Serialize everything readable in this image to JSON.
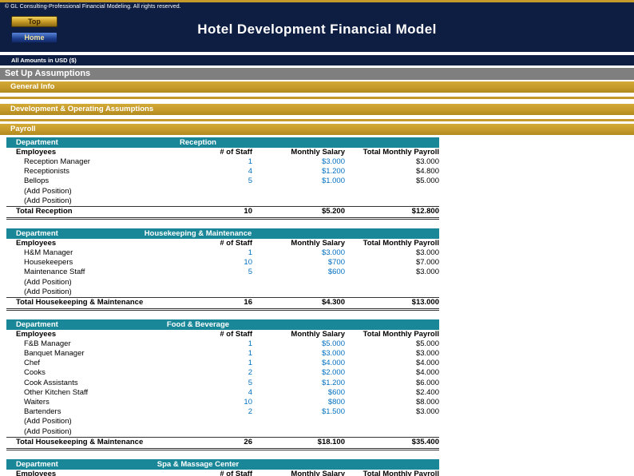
{
  "header": {
    "copyright": "© GL Consulting-Professional Financial Modeling. All rights reserved.",
    "title": "Hotel Development Financial Model",
    "top_button": "Top",
    "home_button": "Home"
  },
  "subheader": {
    "amounts_note": "All Amounts in  USD ($)"
  },
  "bands": {
    "setup": "Set Up Assumptions",
    "general_info": "General Info",
    "dev_ops": "Development & Operating Assumptions",
    "payroll": "Payroll"
  },
  "table": {
    "dept_label": "Department",
    "columns": [
      "Employees",
      "# of Staff",
      "Monthly Salary",
      "Total Monthly Payroll"
    ]
  },
  "sections": [
    {
      "name": "Reception",
      "rows": [
        {
          "label": "Reception Manager",
          "staff": "1",
          "salary": "$3.000",
          "total": "$3.000"
        },
        {
          "label": "Receptionists",
          "staff": "4",
          "salary": "$1.200",
          "total": "$4.800"
        },
        {
          "label": "Bellops",
          "staff": "5",
          "salary": "$1.000",
          "total": "$5.000"
        },
        {
          "label": "(Add Position)",
          "staff": "",
          "salary": "",
          "total": ""
        },
        {
          "label": "(Add Position)",
          "staff": "",
          "salary": "",
          "total": ""
        }
      ],
      "total": {
        "label": "Total Reception",
        "staff": "10",
        "salary": "$5.200",
        "total": "$12.800"
      }
    },
    {
      "name": "Housekeeping & Maintenance",
      "rows": [
        {
          "label": "H&M Manager",
          "staff": "1",
          "salary": "$3.000",
          "total": "$3.000"
        },
        {
          "label": "Housekeepers",
          "staff": "10",
          "salary": "$700",
          "total": "$7.000"
        },
        {
          "label": "Maintenance Staff",
          "staff": "5",
          "salary": "$600",
          "total": "$3.000"
        },
        {
          "label": "(Add Position)",
          "staff": "",
          "salary": "",
          "total": ""
        },
        {
          "label": "(Add Position)",
          "staff": "",
          "salary": "",
          "total": ""
        }
      ],
      "total": {
        "label": "Total Housekeeping & Maintenance",
        "staff": "16",
        "salary": "$4.300",
        "total": "$13.000"
      }
    },
    {
      "name": "Food & Beverage",
      "rows": [
        {
          "label": "F&B Manager",
          "staff": "1",
          "salary": "$5.000",
          "total": "$5.000"
        },
        {
          "label": "Banquet Manager",
          "staff": "1",
          "salary": "$3.000",
          "total": "$3.000"
        },
        {
          "label": "Chef",
          "staff": "1",
          "salary": "$4.000",
          "total": "$4.000"
        },
        {
          "label": "Cooks",
          "staff": "2",
          "salary": "$2.000",
          "total": "$4.000"
        },
        {
          "label": "Cook Assistants",
          "staff": "5",
          "salary": "$1.200",
          "total": "$6.000"
        },
        {
          "label": "Other Kitchen Staff",
          "staff": "4",
          "salary": "$600",
          "total": "$2.400"
        },
        {
          "label": "Waiters",
          "staff": "10",
          "salary": "$800",
          "total": "$8.000"
        },
        {
          "label": "Bartenders",
          "staff": "2",
          "salary": "$1.500",
          "total": "$3.000"
        },
        {
          "label": "(Add Position)",
          "staff": "",
          "salary": "",
          "total": ""
        },
        {
          "label": "(Add Position)",
          "staff": "",
          "salary": "",
          "total": ""
        }
      ],
      "total": {
        "label": "Total Housekeeping & Maintenance",
        "staff": "26",
        "salary": "$18.100",
        "total": "$35.400"
      }
    },
    {
      "name": "Spa & Massage Center",
      "rows": [],
      "total": null
    }
  ],
  "colors": {
    "navy": "#0E1E42",
    "gold": "#C6992B",
    "teal": "#1A8799",
    "gray": "#7F7F7F",
    "input_blue": "#0070C0"
  }
}
